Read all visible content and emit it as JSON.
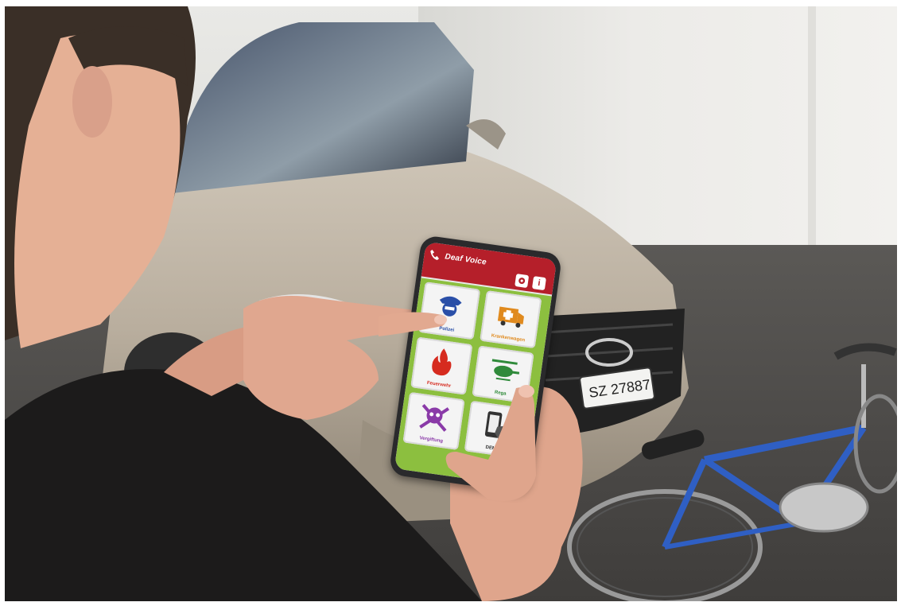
{
  "app": {
    "title": "Deaf Voice",
    "settings_icon": "gear-icon",
    "info_icon": "info-icon",
    "info_glyph": "i",
    "header_color": "#b51f2a",
    "grid_color": "#8cbf3f"
  },
  "tiles": [
    {
      "label": "Polizei",
      "icon": "police-officer-icon",
      "color": "#2a4fa8"
    },
    {
      "label": "Krankenwagen",
      "icon": "ambulance-icon",
      "color": "#e08a1e"
    },
    {
      "label": "Feuerwehr",
      "icon": "fire-icon",
      "color": "#d62b1f"
    },
    {
      "label": "Rega",
      "icon": "helicopter-icon",
      "color": "#2f8a3a"
    },
    {
      "label": "Vergiftung",
      "icon": "skull-crossbones-icon",
      "color": "#8a3aa8"
    },
    {
      "label": "DEMO",
      "icon": "phone-tap-icon",
      "color": "#333333"
    }
  ],
  "license_plate": {
    "text": "SZ 27887"
  }
}
